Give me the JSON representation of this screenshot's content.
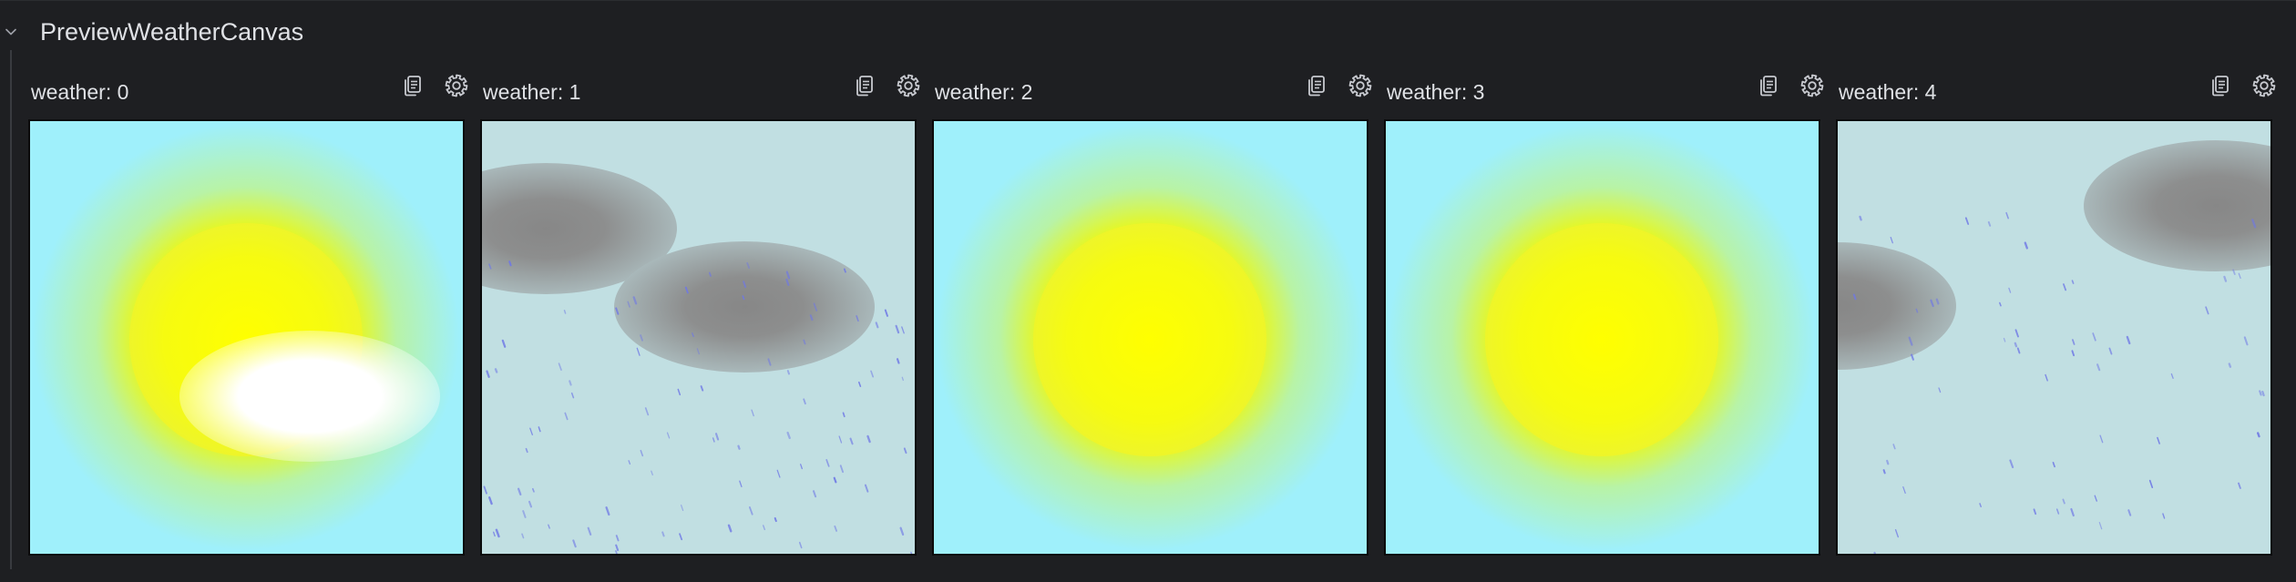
{
  "group": {
    "title": "PreviewWeatherCanvas",
    "chevron_icon": "chevron-down-icon"
  },
  "colors": {
    "background": "#1e1f22",
    "text": "#dfe1e5",
    "sky": "#9ff0fb",
    "overcast": "#c1dfe2",
    "sun": "#ffff00",
    "cloud_dark": "#878787",
    "rain_drop": "#6f78e6"
  },
  "previews": [
    {
      "label": "weather: 0",
      "copy_icon": "copy-icon",
      "settings_icon": "gear-icon"
    },
    {
      "label": "weather: 1",
      "copy_icon": "copy-icon",
      "settings_icon": "gear-icon"
    },
    {
      "label": "weather: 2",
      "copy_icon": "copy-icon",
      "settings_icon": "gear-icon"
    },
    {
      "label": "weather: 3",
      "copy_icon": "copy-icon",
      "settings_icon": "gear-icon"
    },
    {
      "label": "weather: 4",
      "copy_icon": "copy-icon",
      "settings_icon": "gear-icon"
    }
  ]
}
